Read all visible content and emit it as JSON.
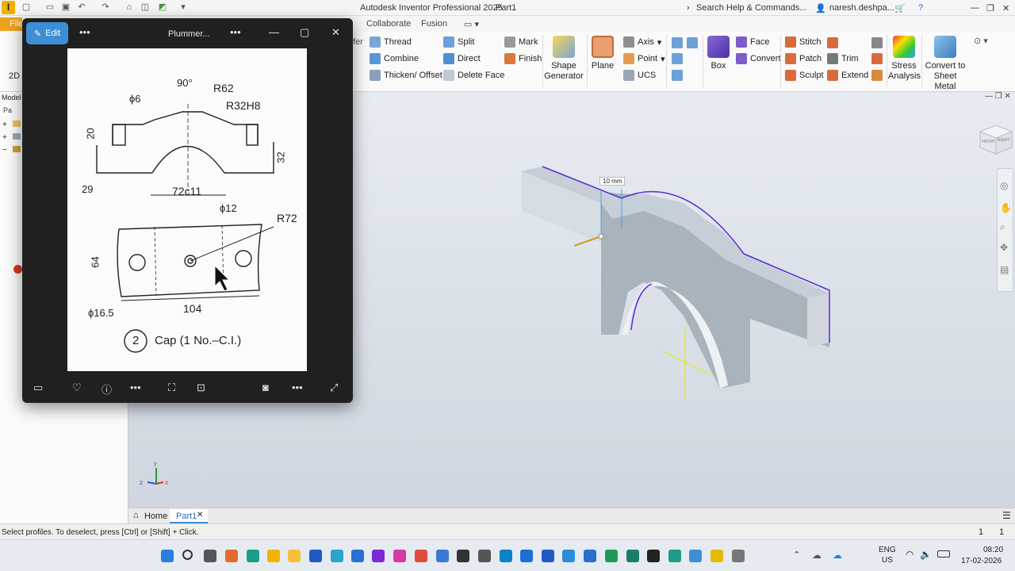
{
  "app": {
    "title": "Autodesk Inventor Professional 2025",
    "document": "Part1",
    "search_placeholder": "Search Help & Commands...",
    "user": "naresh.deshpa...",
    "logo_letter": "I"
  },
  "tabs": {
    "file": "File",
    "collaborate": "Collaborate",
    "fusion": "Fusion"
  },
  "ribbon": {
    "left_cut": "fer",
    "sketch_2d": "2D",
    "thread": "Thread",
    "combine": "Combine",
    "thicken": "Thicken/ Offset",
    "split": "Split",
    "direct": "Direct",
    "delete_face": "Delete Face",
    "mark": "Mark",
    "finish": "Finish",
    "shape_generator": [
      "Shape",
      "Generator"
    ],
    "plane": "Plane",
    "axis": "Axis",
    "point": "Point",
    "ucs": "UCS",
    "box": "Box",
    "face": "Face",
    "convert": "Convert",
    "stitch": "Stitch",
    "patch": "Patch",
    "sculpt": "Sculpt",
    "trim": "Trim",
    "extend": "Extend",
    "stress": [
      "Stress",
      "Analysis"
    ],
    "sheet_metal": [
      "Convert to",
      "Sheet Metal"
    ]
  },
  "browser": {
    "label": "Model",
    "item": "Pa"
  },
  "viewer": {
    "edit_label": "Edit",
    "title": "Plummer..."
  },
  "drawing": {
    "dim_90": "90°",
    "dim_r62": "R62",
    "dim_phi6": "ϕ6",
    "dim_r32h8": "R32H8",
    "dim_20": "20",
    "dim_32": "32",
    "dim_29": "29",
    "dim_72c11": "72c11",
    "dim_phi12": "ϕ12",
    "dim_r72": "R72",
    "dim_64": "64",
    "dim_104": "104",
    "dim_phi165": "ϕ16.5",
    "part_no": "2",
    "caption": "Cap (1 No.–C.I.)"
  },
  "viewport": {
    "dimension": "10 mm",
    "viewcube_front": "FRONT",
    "viewcube_right": "RIGHT",
    "axis_x": "x",
    "axis_y": "y",
    "axis_z": "z"
  },
  "doc_tabs": {
    "home": "Home",
    "part": "Part1"
  },
  "status": {
    "message": "Select profiles. To deselect, press [Ctrl] or [Shift] + Click.",
    "count1": "1",
    "count2": "1"
  },
  "taskbar": {
    "lang1": "ENG",
    "lang2": "US",
    "time": "08:20",
    "date": "17-02-2026"
  },
  "colors": {
    "accent": "#3c8fd6",
    "edge": "#5b2bd6",
    "file_tab": "#f0a020",
    "model_face": "#b9c4cc"
  }
}
